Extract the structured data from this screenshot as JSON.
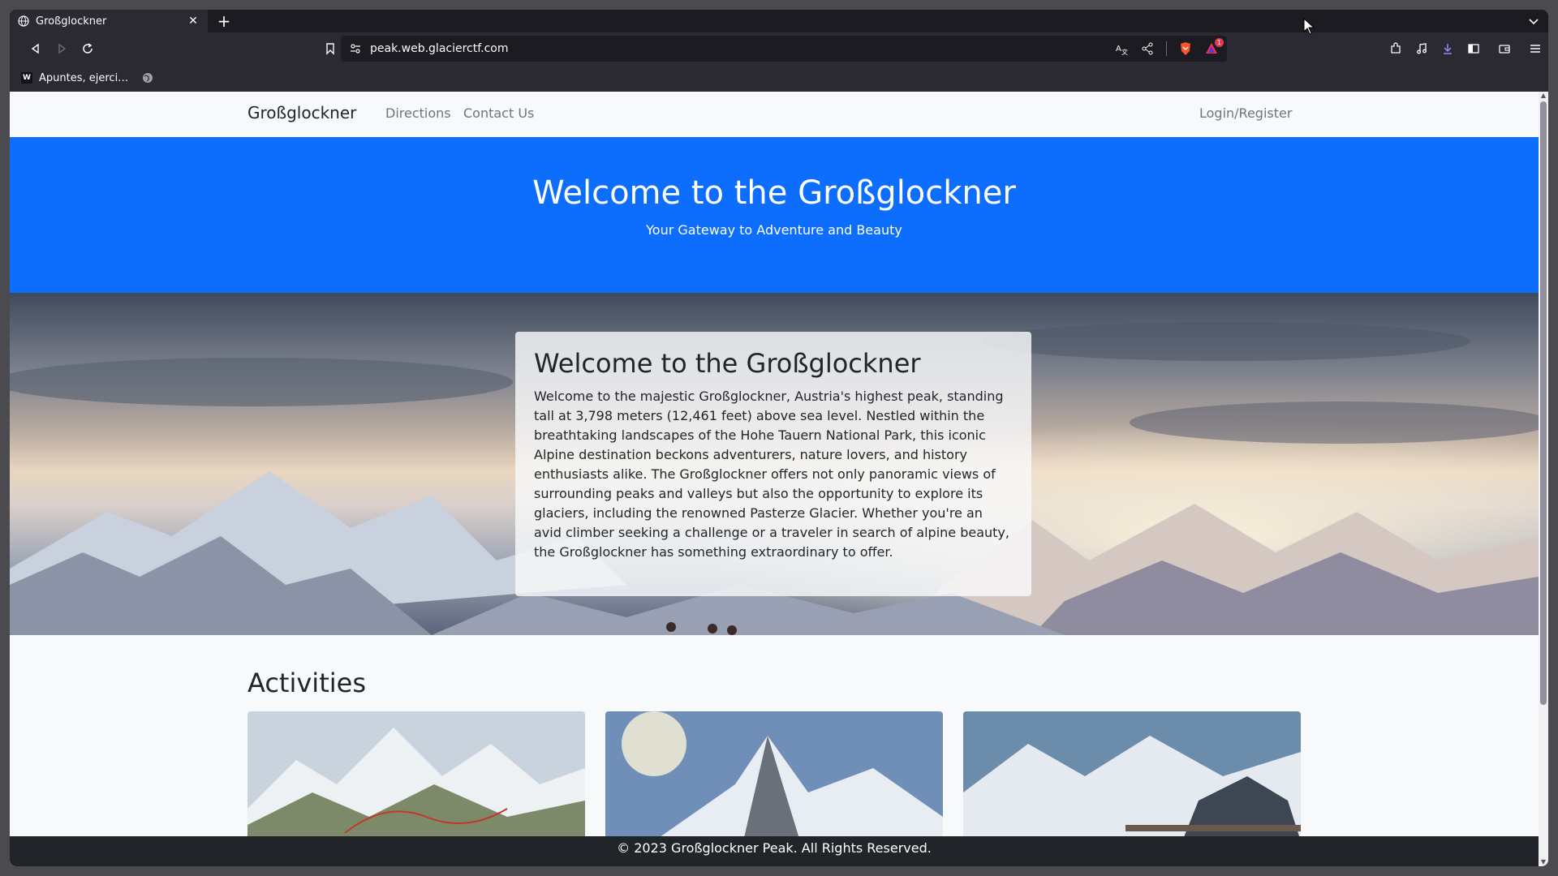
{
  "browser": {
    "tab_title": "Großglockner",
    "url": "peak.web.glacierctf.com",
    "bookmark_label": "Apuntes, ejerci…",
    "bookmark_favicon": "W",
    "notification_count": "1"
  },
  "site": {
    "brand": "Großglockner",
    "nav": [
      "Directions",
      "Contact Us"
    ],
    "login": "Login/Register",
    "hero_title": "Welcome to the Großglockner",
    "hero_subtitle": "Your Gateway to Adventure and Beauty",
    "card_title": "Welcome to the Großglockner",
    "card_text": "Welcome to the majestic Großglockner, Austria's highest peak, standing tall at 3,798 meters (12,461 feet) above sea level. Nestled within the breathtaking landscapes of the Hohe Tauern National Park, this iconic Alpine destination beckons adventurers, nature lovers, and history enthusiasts alike. The Großglockner offers not only panoramic views of surrounding peaks and valleys but also the opportunity to explore its glaciers, including the renowned Pasterze Glacier. Whether you're an avid climber seeking a challenge or a traveler in search of alpine beauty, the Großglockner has something extraordinary to offer.",
    "activities_heading": "Activities",
    "footer": "© 2023 Großglockner Peak. All Rights Reserved."
  },
  "colors": {
    "primary": "#0d6efd",
    "footer_bg": "#212529",
    "browser_bg": "#2b2a33",
    "brave_orange": "#fb542b"
  }
}
